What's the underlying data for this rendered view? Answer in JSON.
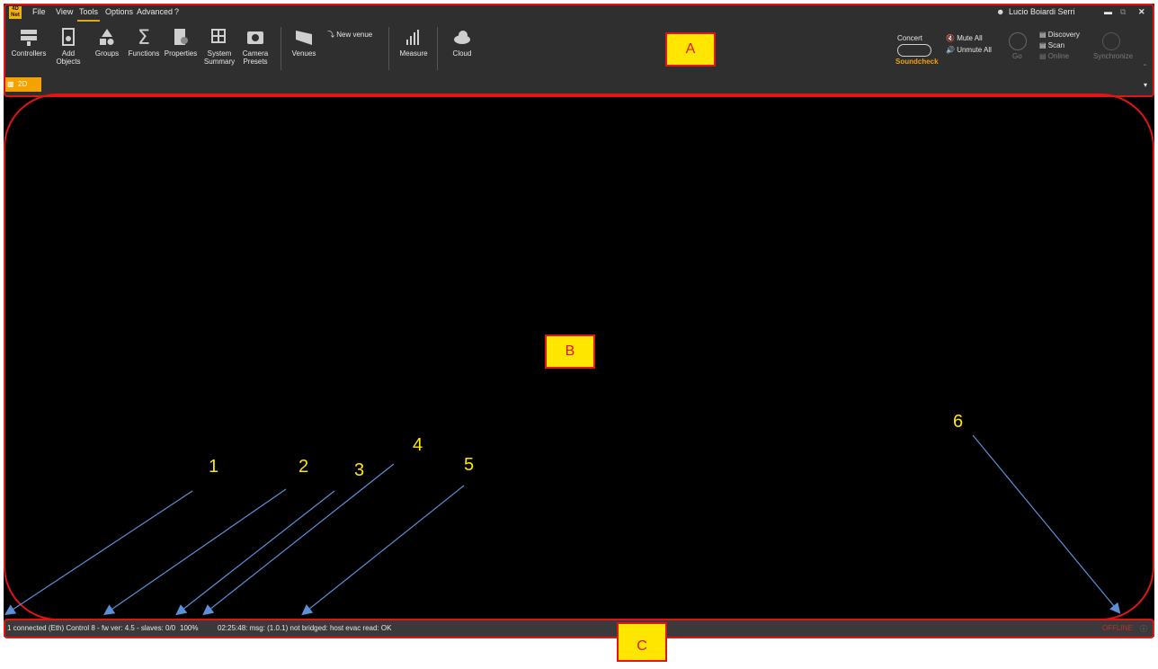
{
  "menu": {
    "logo": "4D Net",
    "items": [
      "File",
      "View",
      "Tools",
      "Options",
      "Advanced",
      "?"
    ],
    "active": "Tools"
  },
  "user": {
    "name": "Lucio Boiardi Serri"
  },
  "tools": [
    {
      "label": "Controllers",
      "icon": "controllers-icon"
    },
    {
      "label": "Add\nObjects",
      "icon": "speaker-icon"
    },
    {
      "label": "Groups",
      "icon": "groups-icon"
    },
    {
      "label": "Functions",
      "icon": "sigma-icon"
    },
    {
      "label": "Properties",
      "icon": "properties-icon"
    },
    {
      "label": "System\nSummary",
      "icon": "summary-icon"
    },
    {
      "label": "Camera\nPresets",
      "icon": "camera-icon"
    },
    {
      "label": "Venues",
      "icon": "venues-icon"
    },
    {
      "label": "New venue",
      "icon": "new-venue-icon"
    },
    {
      "label": "Measure",
      "icon": "measure-icon"
    },
    {
      "label": "Cloud",
      "icon": "cloud-icon"
    }
  ],
  "right": {
    "concert": "Concert",
    "soundcheck": "Soundcheck",
    "mute_all": "Mute All",
    "unmute_all": "Unmute All",
    "go": "Go",
    "discovery": "Discovery",
    "scan": "Scan",
    "online": "Online",
    "synchronize": "Synchronize"
  },
  "tab": {
    "label": "2D"
  },
  "status": {
    "connection": "1 connected (Eth) Control 8 - fw ver: 4.5",
    "slaves": "- slaves: 0/0",
    "percent": "100%",
    "message": "02:25:48: msg: (1.0.1) not bridged: host evac read: OK",
    "offline": "OFFLINE"
  },
  "annotations": {
    "A": "A",
    "B": "B",
    "C": "C",
    "numbers": [
      "1",
      "2",
      "3",
      "4",
      "5",
      "6"
    ]
  },
  "colors": {
    "accent": "#f3a200",
    "annotation_border": "#e01515",
    "annotation_fill": "#ffe600",
    "arrow": "#5b8fd6"
  }
}
